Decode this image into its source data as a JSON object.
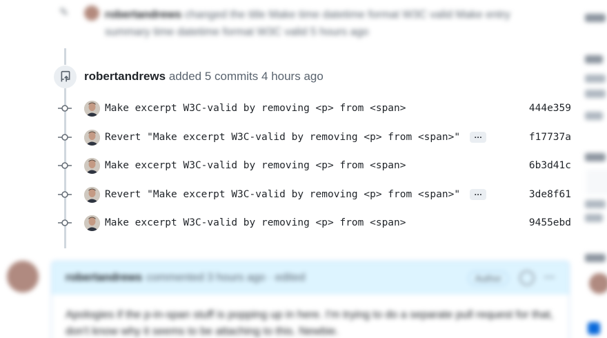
{
  "top_event": {
    "author": "robertandrews",
    "text": "changed the title Make time datetime format W3C valid Make entry summary time datetime format W3C valid 5 hours ago"
  },
  "commits_event": {
    "author": "robertandrews",
    "action": "added 5 commits",
    "time": "4 hours ago",
    "icon": "repo-push-icon"
  },
  "commits": [
    {
      "message": "Make excerpt W3C-valid by removing <p> from <span>",
      "sha": "444e359",
      "has_more": false
    },
    {
      "message": "Revert \"Make excerpt W3C-valid by removing <p> from <span>\"",
      "sha": "f17737a",
      "has_more": true
    },
    {
      "message": "Make excerpt W3C-valid by removing <p> from <span>",
      "sha": "6b3d41c",
      "has_more": false
    },
    {
      "message": "Revert \"Make excerpt W3C-valid by removing <p> from <span>\"",
      "sha": "3de8f61",
      "has_more": true
    },
    {
      "message": "Make excerpt W3C-valid by removing <p> from <span>",
      "sha": "9455ebd",
      "has_more": false
    }
  ],
  "ellipsis_label": "…",
  "comment": {
    "author": "robertandrews",
    "meta": "commented 3 hours ago · edited",
    "role": "Author",
    "more": "···",
    "body": "Apologies if the p-in-span stuff is popping up in here. I'm trying to do a separate pull request for that, don't know why it seems to be attaching to this. Newbie."
  },
  "colors": {
    "rail": "#d0d7de",
    "comment_header_bg": "#ddf4ff",
    "accent": "#0969da"
  }
}
